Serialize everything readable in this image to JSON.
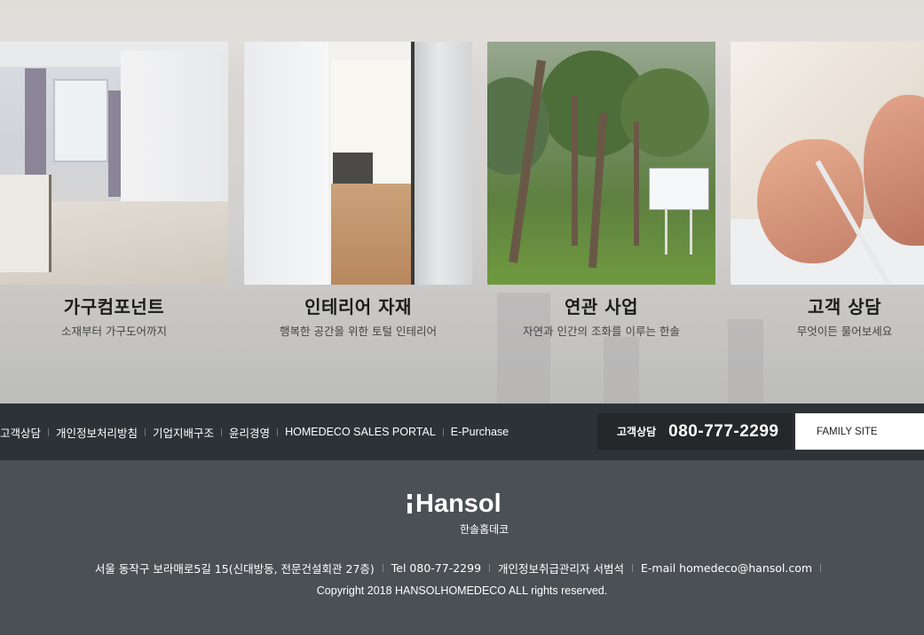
{
  "cards": [
    {
      "title": "가구컴포넌트",
      "subtitle": "소재부터 가구도어까지"
    },
    {
      "title": "인테리어 자재",
      "subtitle": "행복한 공간을 위한 토털 인테리어"
    },
    {
      "title": "연관 사업",
      "subtitle": "자연과 인간의 조화를 이루는 한솔"
    },
    {
      "title": "고객 상담",
      "subtitle": "무엇이든 물어보세요"
    }
  ],
  "nav": {
    "links": [
      "고객상담",
      "개인정보처리방침",
      "기업지배구조",
      "윤리경영",
      "HOMEDECO SALES PORTAL",
      "E-Purchase"
    ],
    "phone_label": "고객상담",
    "phone_number": "080-777-2299",
    "family_site": "FAMILY SITE"
  },
  "footer": {
    "logo": "Hansol",
    "logo_sub": "한솔홈데코",
    "address": "서울 동작구 보라매로5길 15(신대방동, 전문건설회관 27층)",
    "tel": "Tel 080-77-2299",
    "privacy_officer": "개인정보취급관리자 서범석",
    "email": "E-mail homedeco@hansol.com",
    "copyright": "Copyright 2018 HANSOLHOMEDECO ALL rights reserved."
  },
  "colors": {
    "nav_bg": "#2d3236",
    "phone_bg": "#24282b",
    "footer_bg": "#4b5055"
  }
}
